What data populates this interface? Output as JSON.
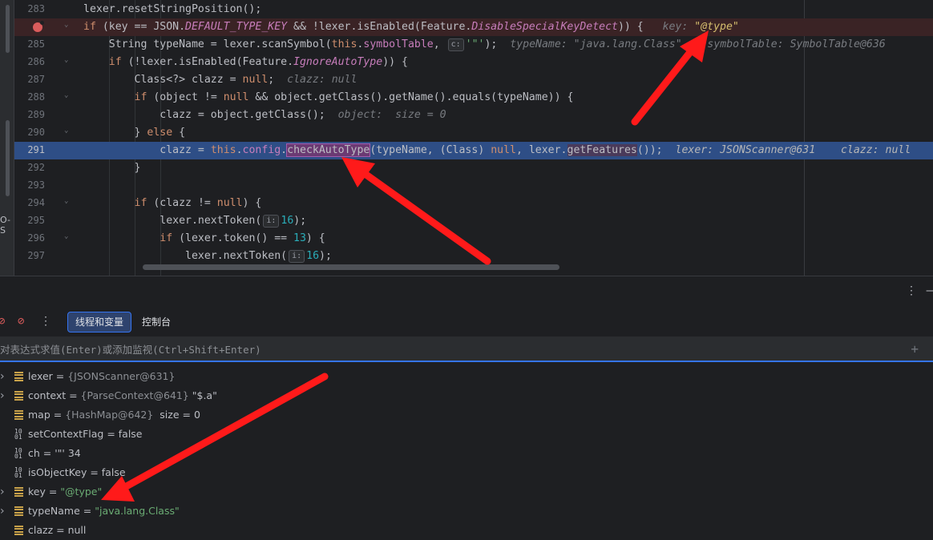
{
  "editor": {
    "left_fragment": "O-S",
    "lines": [
      {
        "num": "283",
        "fold": "",
        "kind": "normal"
      },
      {
        "num": "",
        "fold": "⌄",
        "kind": "breakpoint"
      },
      {
        "num": "285",
        "fold": "",
        "kind": "normal"
      },
      {
        "num": "286",
        "fold": "⌄",
        "kind": "normal"
      },
      {
        "num": "287",
        "fold": "",
        "kind": "normal"
      },
      {
        "num": "288",
        "fold": "⌄",
        "kind": "normal"
      },
      {
        "num": "289",
        "fold": "",
        "kind": "normal"
      },
      {
        "num": "290",
        "fold": "⌄",
        "kind": "normal"
      },
      {
        "num": "291",
        "fold": "",
        "kind": "exec"
      },
      {
        "num": "292",
        "fold": "",
        "kind": "normal"
      },
      {
        "num": "293",
        "fold": "",
        "kind": "normal"
      },
      {
        "num": "294",
        "fold": "⌄",
        "kind": "normal"
      },
      {
        "num": "295",
        "fold": "",
        "kind": "normal"
      },
      {
        "num": "296",
        "fold": "⌄",
        "kind": "normal"
      },
      {
        "num": "297",
        "fold": "",
        "kind": "normal"
      }
    ],
    "code": {
      "l283": {
        "text": "lexer.resetStringPosition();"
      },
      "l284": {
        "a": "if",
        "b": " (key == JSON.",
        "c": "DEFAULT_TYPE_KEY",
        "d": " && !lexer.isEnabled(Feature.",
        "e": "DisableSpecialKeyDetect",
        "f": ")) {",
        "hint_name": "key: ",
        "hint_val": "\"@type\""
      },
      "l285": {
        "a": "String typeName = lexer.scanSymbol(",
        "b": "this",
        "c": ".",
        "d": "symbolTable",
        "e": ", ",
        "badge": "c:",
        "f": "'\"'",
        "g": ");",
        "hint1": "typeName: \"java.lang.Class\"",
        "hint2": "symbolTable: SymbolTable@636"
      },
      "l286": {
        "a": "if",
        "b": " (!lexer.isEnabled(Feature.",
        "c": "IgnoreAutoType",
        "d": ")) {"
      },
      "l287": {
        "a": "Class<?> clazz = ",
        "b": "null",
        "c": ";",
        "hint": "clazz: null"
      },
      "l288": {
        "a": "if",
        "b": " (object != ",
        "c": "null",
        "d": " && object.getClass().getName().equals(typeName)) {"
      },
      "l289": {
        "a": "clazz = object.getClass();",
        "hint": "object:  size = 0"
      },
      "l290": {
        "a": "} ",
        "b": "else",
        "c": " {"
      },
      "l291": {
        "a": "clazz = ",
        "b": "this",
        "c": ".",
        "d": "config",
        "e": ".",
        "f": "checkAutoType",
        "g": "(typeName, (Class) ",
        "h": "null",
        "i": ", lexer.",
        "j": "getFeatures",
        "k": "());",
        "hint1": "lexer: JSONScanner@631",
        "hint2": "clazz: null"
      },
      "l292": {
        "text": "}"
      },
      "l293": {
        "text": ""
      },
      "l294": {
        "a": "if",
        "b": " (clazz != ",
        "c": "null",
        "d": ") {"
      },
      "l295": {
        "a": "lexer.nextToken(",
        "badge": "i:",
        "b": "16",
        "c": ");"
      },
      "l296": {
        "a": "if",
        "b": " (lexer.token() == ",
        "c": "13",
        "d": ") {"
      },
      "l297": {
        "a": "lexer.nextToken(",
        "badge": "i:",
        "b": "16",
        "c": ");"
      }
    }
  },
  "panel": {
    "more_icon": "⋮",
    "min_icon": "–",
    "tabs": [
      {
        "label": "线程和变量",
        "active": true
      },
      {
        "label": "控制台",
        "active": false
      }
    ],
    "eval_placeholder": "对表达式求值(Enter)或添加监视(Ctrl+Shift+Enter)",
    "add_watch_icon": "+",
    "variables": [
      {
        "expandable": true,
        "type": "obj",
        "name": "lexer",
        "eq": " = ",
        "ref": "{JSONScanner@631}",
        "val": ""
      },
      {
        "expandable": true,
        "type": "obj",
        "name": "context",
        "eq": " = ",
        "ref": "{ParseContext@641}",
        "val": " \"$.a\""
      },
      {
        "expandable": false,
        "type": "obj",
        "name": "map",
        "eq": " = ",
        "ref": "{HashMap@642}",
        "val": "  size = 0"
      },
      {
        "expandable": false,
        "type": "prim",
        "name": "setContextFlag",
        "eq": " = ",
        "ref": "",
        "val": "false"
      },
      {
        "expandable": false,
        "type": "prim",
        "name": "ch",
        "eq": " = ",
        "ref": "",
        "val": "'\"' 34"
      },
      {
        "expandable": false,
        "type": "prim",
        "name": "isObjectKey",
        "eq": " = ",
        "ref": "",
        "val": "false"
      },
      {
        "expandable": true,
        "type": "obj",
        "name": "key",
        "eq": " = ",
        "ref": "",
        "str": "\"@type\""
      },
      {
        "expandable": true,
        "type": "obj",
        "name": "typeName",
        "eq": " = ",
        "ref": "",
        "str": "\"java.lang.Class\""
      },
      {
        "expandable": false,
        "type": "obj",
        "name": "clazz",
        "eq": " = ",
        "ref": "",
        "val": "null"
      }
    ]
  },
  "colors": {
    "annotation_arrow": "#ff1a1a",
    "exec_line": "#2e4e86",
    "breakpoint": "#db5c5c"
  }
}
